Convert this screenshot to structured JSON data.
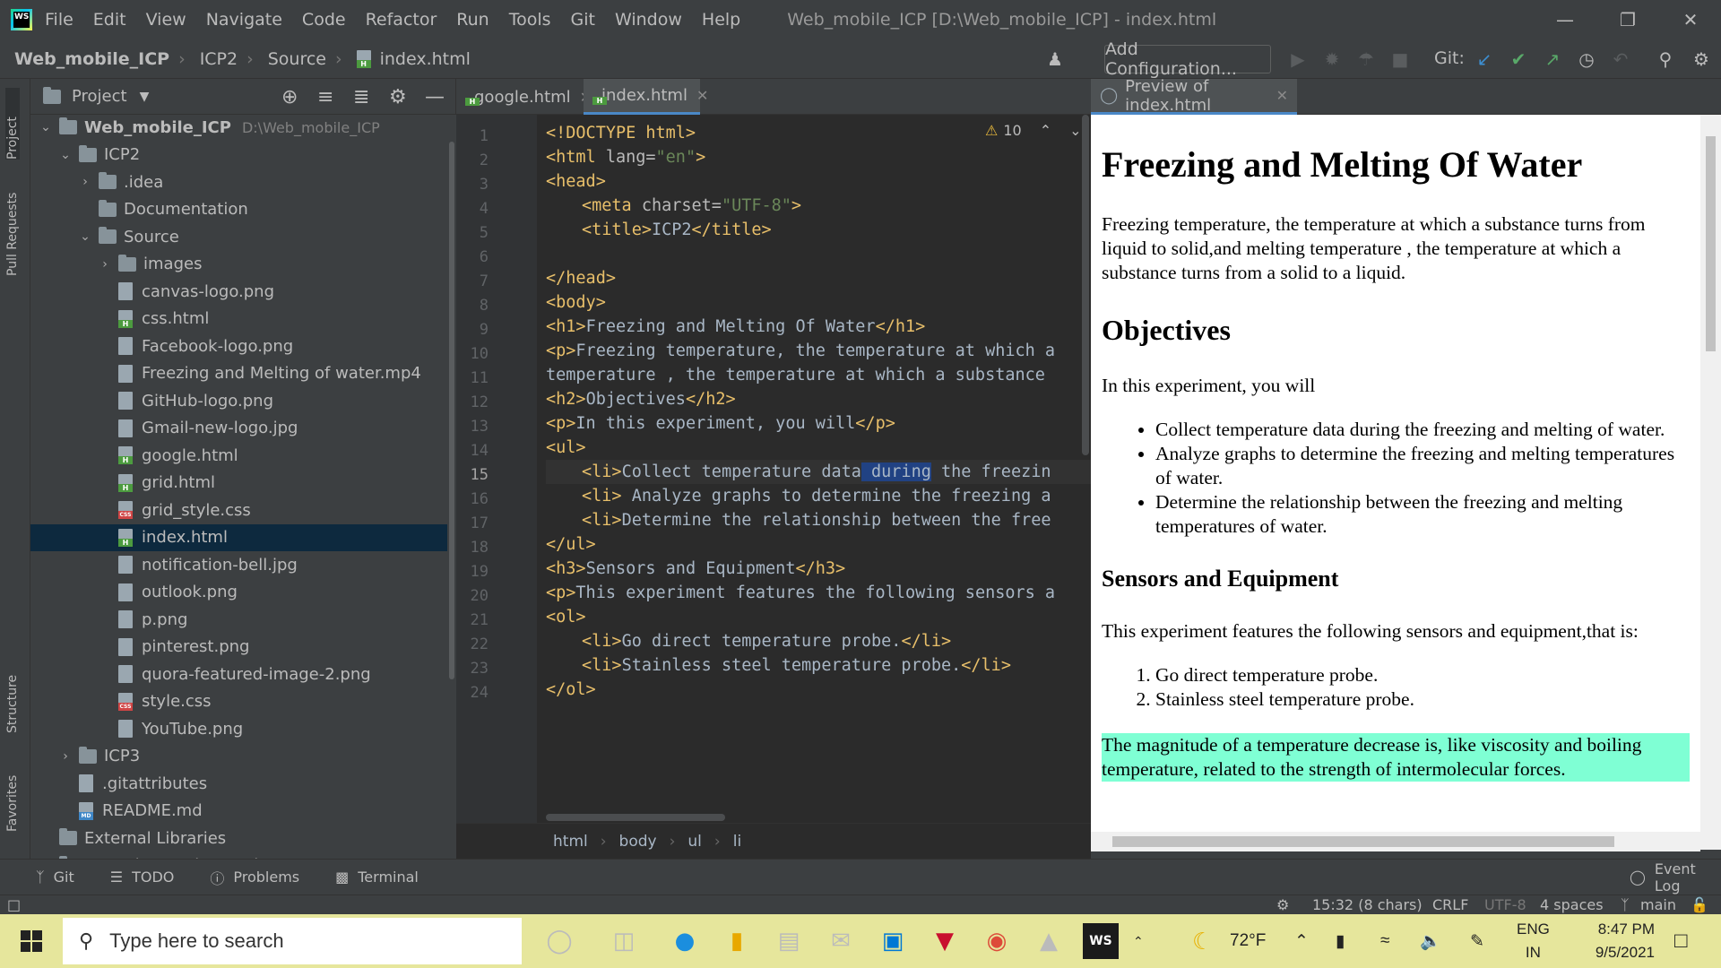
{
  "menubar": {
    "logo_text": "WS",
    "items": [
      "File",
      "Edit",
      "View",
      "Navigate",
      "Code",
      "Refactor",
      "Run",
      "Tools",
      "Git",
      "Window",
      "Help"
    ],
    "window_title": "Web_mobile_ICP [D:\\Web_mobile_ICP] - index.html"
  },
  "navbar": {
    "crumbs": [
      "Web_mobile_ICP",
      "ICP2",
      "Source",
      "index.html"
    ],
    "add_config": "Add Configuration...",
    "git_label": "Git:"
  },
  "stripe": {
    "project": "Project",
    "pull_requests": "Pull Requests",
    "structure": "Structure",
    "favorites": "Favorites"
  },
  "project_panel": {
    "title": "Project",
    "tree": [
      {
        "label": "Web_mobile_ICP",
        "extra": "D:\\Web_mobile_ICP",
        "type": "folder",
        "depth": 0,
        "expanded": true
      },
      {
        "label": "ICP2",
        "type": "folder",
        "depth": 1,
        "expanded": true
      },
      {
        "label": ".idea",
        "type": "folder",
        "depth": 2,
        "expanded": false
      },
      {
        "label": "Documentation",
        "type": "folder",
        "depth": 2
      },
      {
        "label": "Source",
        "type": "folder",
        "depth": 2,
        "expanded": true
      },
      {
        "label": "images",
        "type": "folder",
        "depth": 3,
        "expanded": false
      },
      {
        "label": "canvas-logo.png",
        "type": "file",
        "depth": 3
      },
      {
        "label": "css.html",
        "type": "html",
        "depth": 3
      },
      {
        "label": "Facebook-logo.png",
        "type": "file",
        "depth": 3
      },
      {
        "label": "Freezing and Melting of water.mp4",
        "type": "file",
        "depth": 3
      },
      {
        "label": "GitHub-logo.png",
        "type": "file",
        "depth": 3
      },
      {
        "label": "Gmail-new-logo.jpg",
        "type": "file",
        "depth": 3
      },
      {
        "label": "google.html",
        "type": "html",
        "depth": 3
      },
      {
        "label": "grid.html",
        "type": "html",
        "depth": 3
      },
      {
        "label": "grid_style.css",
        "type": "css",
        "depth": 3
      },
      {
        "label": "index.html",
        "type": "html",
        "depth": 3,
        "selected": true
      },
      {
        "label": "notification-bell.jpg",
        "type": "file",
        "depth": 3
      },
      {
        "label": "outlook.png",
        "type": "file",
        "depth": 3
      },
      {
        "label": "p.png",
        "type": "file",
        "depth": 3
      },
      {
        "label": "pinterest.png",
        "type": "file",
        "depth": 3
      },
      {
        "label": "quora-featured-image-2.png",
        "type": "file",
        "depth": 3
      },
      {
        "label": "style.css",
        "type": "css",
        "depth": 3
      },
      {
        "label": "YouTube.png",
        "type": "file",
        "depth": 3
      },
      {
        "label": "ICP3",
        "type": "folder",
        "depth": 1,
        "expanded": false
      },
      {
        "label": ".gitattributes",
        "type": "file",
        "depth": 1
      },
      {
        "label": "README.md",
        "type": "md",
        "depth": 1
      },
      {
        "label": "External Libraries",
        "type": "lib",
        "depth": 0
      },
      {
        "label": "Scratches and Consoles",
        "type": "scratch",
        "depth": 0
      }
    ]
  },
  "editor": {
    "tabs": [
      {
        "label": "google.html",
        "active": false
      },
      {
        "label": "index.html",
        "active": true
      }
    ],
    "warnings": "10",
    "current_line": 15,
    "lines": [
      {
        "n": 1,
        "indent": 0,
        "code": "<!DOCTYPE html>"
      },
      {
        "n": 2,
        "indent": 0,
        "code": "<html lang=\"en\">"
      },
      {
        "n": 3,
        "indent": 0,
        "code": "<head>"
      },
      {
        "n": 4,
        "indent": 1,
        "code": "<meta charset=\"UTF-8\">"
      },
      {
        "n": 5,
        "indent": 1,
        "code": "<title>ICP2</title>"
      },
      {
        "n": 6,
        "indent": 0,
        "code": ""
      },
      {
        "n": 7,
        "indent": 0,
        "code": "</head>"
      },
      {
        "n": 8,
        "indent": 0,
        "code": "<body>"
      },
      {
        "n": 9,
        "indent": 0,
        "code": "<h1>Freezing and Melting Of Water</h1>"
      },
      {
        "n": 10,
        "indent": 0,
        "code": "<p>Freezing temperature, the temperature at which a"
      },
      {
        "n": 11,
        "indent": 0,
        "code": "temperature , the temperature at which a substance"
      },
      {
        "n": 12,
        "indent": 0,
        "code": "<h2>Objectives</h2>"
      },
      {
        "n": 13,
        "indent": 0,
        "code": "<p>In this experiment, you will</p>"
      },
      {
        "n": 14,
        "indent": 0,
        "code": "<ul>"
      },
      {
        "n": 15,
        "indent": 1,
        "code": "<li>Collect temperature data during the freezin"
      },
      {
        "n": 16,
        "indent": 1,
        "code": "<li> Analyze graphs to determine the freezing a"
      },
      {
        "n": 17,
        "indent": 1,
        "code": "<li>Determine the relationship between the free"
      },
      {
        "n": 18,
        "indent": 0,
        "code": "</ul>"
      },
      {
        "n": 19,
        "indent": 0,
        "code": "<h3>Sensors and Equipment</h3>"
      },
      {
        "n": 20,
        "indent": 0,
        "code": "<p>This experiment features the following sensors a"
      },
      {
        "n": 21,
        "indent": 0,
        "code": "<ol>"
      },
      {
        "n": 22,
        "indent": 1,
        "code": "<li>Go direct temperature probe.</li>"
      },
      {
        "n": 23,
        "indent": 1,
        "code": "<li>Stainless steel temperature probe.</li>"
      },
      {
        "n": 24,
        "indent": 0,
        "code": "</ol>"
      }
    ],
    "breadcrumbs": [
      "html",
      "body",
      "ul",
      "li"
    ]
  },
  "preview": {
    "tab_label": "Preview of index.html",
    "h1": "Freezing and Melting Of Water",
    "intro": "Freezing temperature, the temperature at which a substance turns from liquid to solid,and melting temperature , the temperature at which a substance turns from a solid to a liquid.",
    "h2": "Objectives",
    "p2": "In this experiment, you will",
    "ul": [
      "Collect temperature data during the freezing and melting of water.",
      "Analyze graphs to determine the freezing and melting temperatures of water.",
      "Determine the relationship between the freezing and melting temperatures of water."
    ],
    "h3": "Sensors and Equipment",
    "p3": "This experiment features the following sensors and equipment,that is:",
    "ol": [
      "Go direct temperature probe.",
      "Stainless steel temperature probe."
    ],
    "highlight": "The magnitude of a temperature decrease is, like viscosity and boiling temperature, related to the strength of intermolecular forces."
  },
  "tool_tabs": [
    "Git",
    "TODO",
    "Problems",
    "Terminal"
  ],
  "event_log": "Event Log",
  "status": {
    "position": "15:32 (8 chars)",
    "line_sep": "CRLF",
    "encoding": "UTF-8",
    "indent": "4 spaces",
    "branch": "main"
  },
  "taskbar": {
    "search_placeholder": "Type here to search",
    "temperature": "72°F",
    "lang1": "ENG",
    "lang2": "IN",
    "time": "8:47 PM",
    "date": "9/5/2021"
  }
}
